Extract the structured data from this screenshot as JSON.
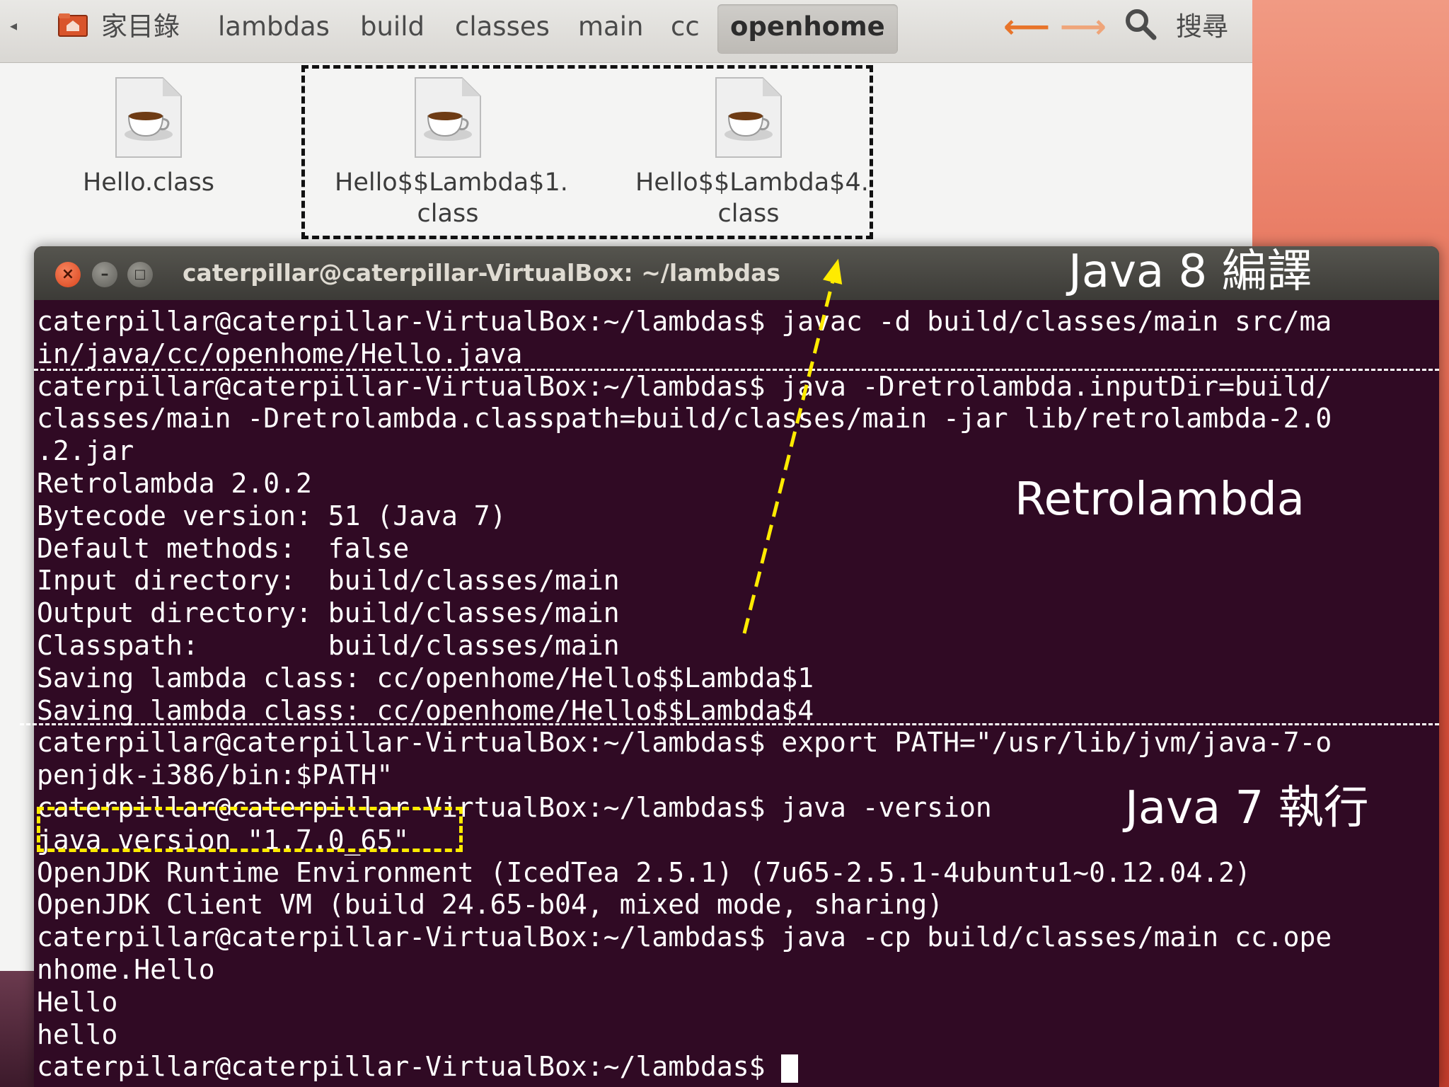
{
  "file_manager": {
    "breadcrumbs": [
      "家目錄",
      "lambdas",
      "build",
      "classes",
      "main",
      "cc",
      "openhome"
    ],
    "active_crumb": "openhome",
    "back_icon": "left-arrow-icon",
    "forward_icon": "right-arrow-icon",
    "search_label": "搜尋",
    "files": [
      {
        "name_line1": "Hello.class",
        "name_line2": ""
      },
      {
        "name_line1": "Hello$$Lambda$1.",
        "name_line2": "class"
      },
      {
        "name_line1": "Hello$$Lambda$4.",
        "name_line2": "class"
      }
    ]
  },
  "terminal": {
    "title": "caterpillar@caterpillar-VirtualBox: ~/lambdas",
    "lines": [
      "caterpillar@caterpillar-VirtualBox:~/lambdas$ javac -d build/classes/main src/ma",
      "in/java/cc/openhome/Hello.java",
      "caterpillar@caterpillar-VirtualBox:~/lambdas$ java -Dretrolambda.inputDir=build/",
      "classes/main -Dretrolambda.classpath=build/classes/main -jar lib/retrolambda-2.0",
      ".2.jar",
      "Retrolambda 2.0.2",
      "Bytecode version: 51 (Java 7)",
      "Default methods:  false",
      "Input directory:  build/classes/main",
      "Output directory: build/classes/main",
      "Classpath:        build/classes/main",
      "Saving lambda class: cc/openhome/Hello$$Lambda$1",
      "Saving lambda class: cc/openhome/Hello$$Lambda$4",
      "caterpillar@caterpillar-VirtualBox:~/lambdas$ export PATH=\"/usr/lib/jvm/java-7-o",
      "penjdk-i386/bin:$PATH\"",
      "caterpillar@caterpillar-VirtualBox:~/lambdas$ java -version",
      "java version \"1.7.0_65\"",
      "OpenJDK Runtime Environment (IcedTea 2.5.1) (7u65-2.5.1-4ubuntu1~0.12.04.2)",
      "OpenJDK Client VM (build 24.65-b04, mixed mode, sharing)",
      "caterpillar@caterpillar-VirtualBox:~/lambdas$ java -cp build/classes/main cc.ope",
      "nhome.Hello",
      "Hello",
      "hello",
      "caterpillar@caterpillar-VirtualBox:~/lambdas$ "
    ]
  },
  "annotations": {
    "java8_compile": "Java 8 編譯",
    "retrolambda": "Retrolambda",
    "java7_run": "Java 7 執行"
  },
  "colors": {
    "terminal_bg": "#300a24",
    "highlight_yellow": "#ffeb00",
    "close_button": "#e2542b"
  }
}
